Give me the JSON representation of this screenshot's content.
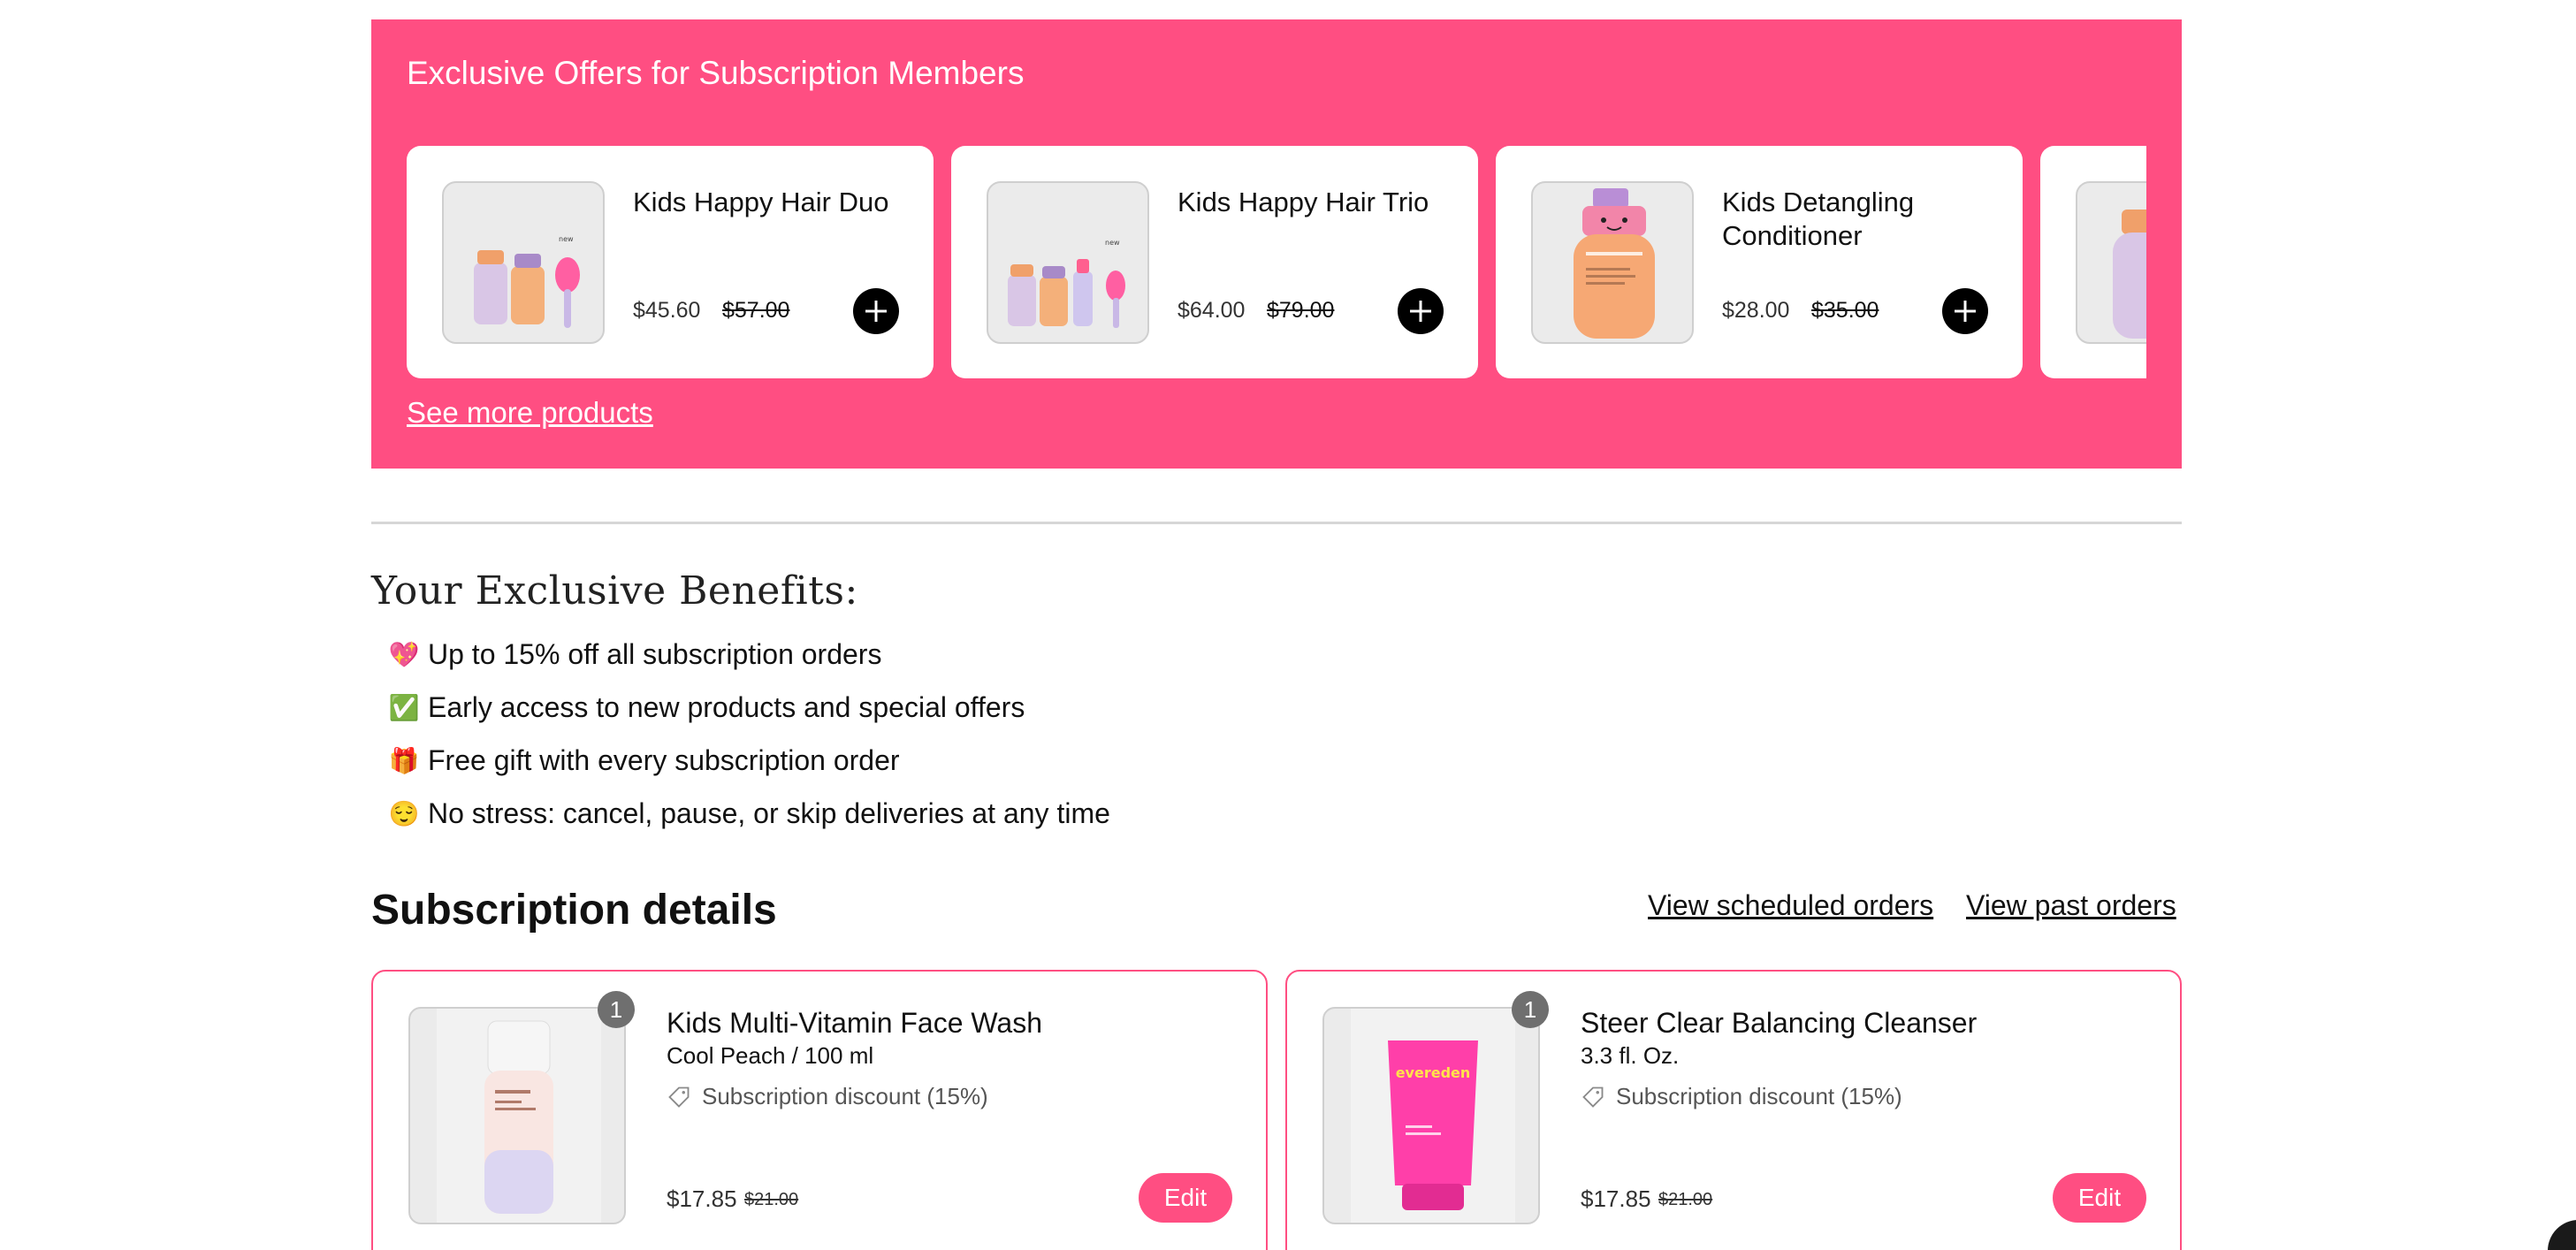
{
  "offers": {
    "title": "Exclusive Offers for Subscription Members",
    "see_more": "See more products",
    "products": [
      {
        "name": "Kids Happy Hair Duo",
        "price": "$45.60",
        "original_price": "$57.00"
      },
      {
        "name": "Kids Happy Hair Trio",
        "price": "$64.00",
        "original_price": "$79.00"
      },
      {
        "name": "Kids Detangling Conditioner",
        "price": "$28.00",
        "original_price": "$35.00"
      }
    ]
  },
  "benefits": {
    "title": "Your Exclusive Benefits:",
    "items": [
      {
        "icon": "💖",
        "text": "Up to 15% off all subscription orders"
      },
      {
        "icon": "✅",
        "text": "Early access to new products and special offers"
      },
      {
        "icon": "🎁",
        "text": "Free gift with every subscription order"
      },
      {
        "icon": "😌",
        "text": "No stress: cancel, pause, or skip deliveries at any time"
      }
    ]
  },
  "subscription": {
    "title": "Subscription details",
    "view_scheduled": "View scheduled orders",
    "view_past": "View past orders",
    "items": [
      {
        "qty": "1",
        "name": "Kids Multi-Vitamin Face Wash",
        "variant": "Cool Peach / 100 ml",
        "discount": "Subscription discount (15%)",
        "price": "$17.85",
        "original_price": "$21.00",
        "edit": "Edit"
      },
      {
        "qty": "1",
        "name": "Steer Clear Balancing Cleanser",
        "variant": "3.3 fl. Oz.",
        "discount": "Subscription discount (15%)",
        "price": "$17.85",
        "original_price": "$21.00",
        "edit": "Edit",
        "brand_text": "evereden"
      }
    ]
  },
  "colors": {
    "accent": "#ff4e82",
    "black": "#000000"
  }
}
